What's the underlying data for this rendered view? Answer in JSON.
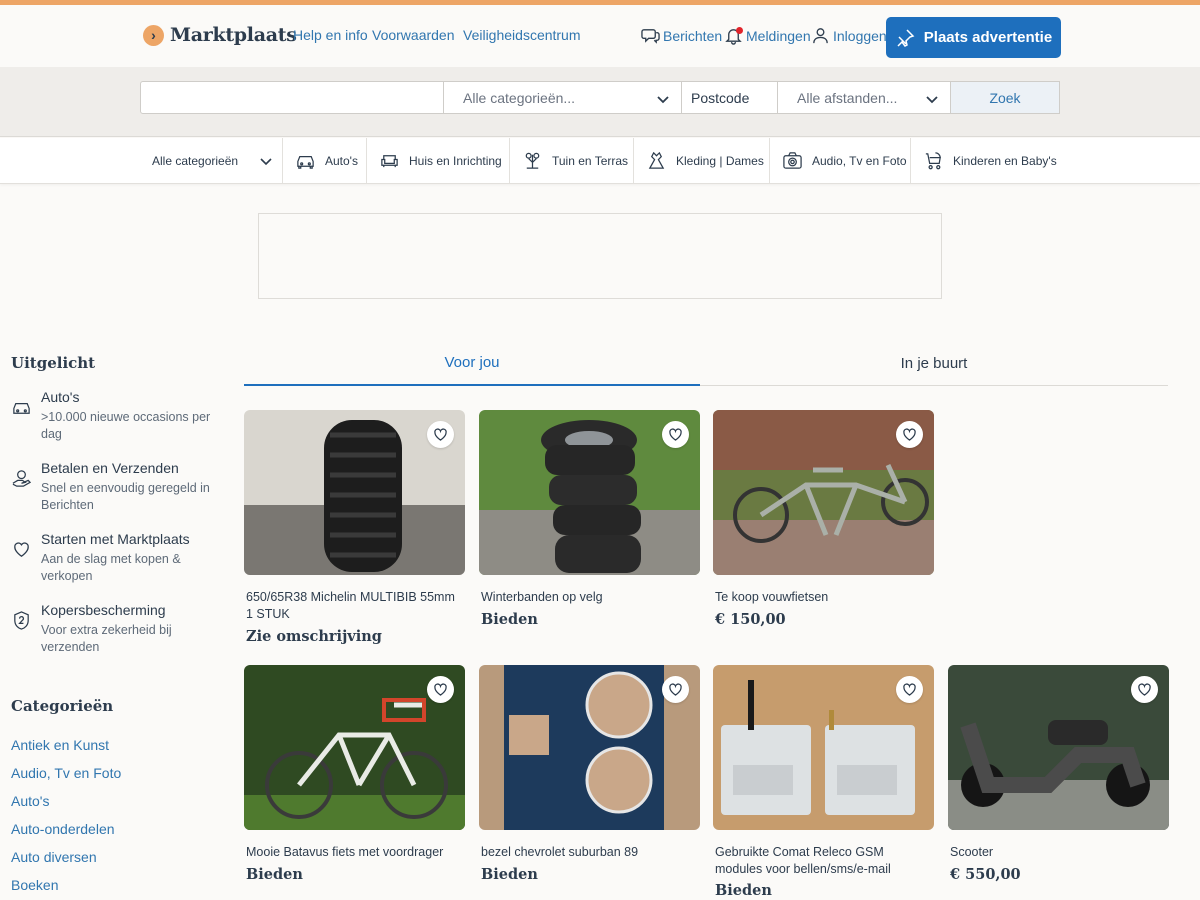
{
  "header": {
    "logo_text": "Marktplaats",
    "links": [
      "Help en info",
      "Voorwaarden",
      "Veiligheidscentrum"
    ],
    "actions": {
      "messages": "Berichten",
      "notifications": "Meldingen",
      "login": "Inloggen"
    },
    "place_ad": "Plaats advertentie"
  },
  "search": {
    "query_value": "",
    "category": "Alle categorieën...",
    "postcode_placeholder": "Postcode",
    "distance": "Alle afstanden...",
    "button": "Zoek"
  },
  "category_bar": {
    "all": "Alle categorieën",
    "items": [
      {
        "label": "Auto's",
        "icon": "car-icon"
      },
      {
        "label": "Huis en Inrichting",
        "icon": "sofa-icon"
      },
      {
        "label": "Tuin en Terras",
        "icon": "garden-icon"
      },
      {
        "label": "Kleding | Dames",
        "icon": "dress-icon"
      },
      {
        "label": "Audio, Tv en Foto",
        "icon": "camera-icon"
      },
      {
        "label": "Kinderen en Baby's",
        "icon": "stroller-icon"
      }
    ]
  },
  "sidebar": {
    "featured_heading": "Uitgelicht",
    "featured": [
      {
        "title": "Auto's",
        "desc": ">10.000 nieuwe occasions per dag",
        "icon": "car-icon"
      },
      {
        "title": "Betalen en Verzenden",
        "desc": "Snel en eenvoudig geregeld in Berichten",
        "icon": "hand-coin-icon"
      },
      {
        "title": "Starten met Marktplaats",
        "desc": "Aan de slag met kopen & verkopen",
        "icon": "heart-icon"
      },
      {
        "title": "Kopersbescherming",
        "desc": "Voor extra zekerheid bij verzenden",
        "icon": "shield-icon"
      }
    ],
    "categories_heading": "Categorieën",
    "categories": [
      "Antiek en Kunst",
      "Audio, Tv en Foto",
      "Auto's",
      "Auto-onderdelen",
      "Auto diversen",
      "Boeken"
    ]
  },
  "tabs": {
    "active": "Voor jou",
    "inactive": "In je buurt"
  },
  "listings": [
    {
      "title": "650/65R38 Michelin MULTIBIB 55mm 1 STUK",
      "price": "Zie omschrijving"
    },
    {
      "title": "Winterbanden op velg",
      "price": "Bieden"
    },
    {
      "title": "Te koop vouwfietsen",
      "price": "€ 150,00"
    },
    {
      "title": "Mooie Batavus fiets met voordrager",
      "price": "Bieden"
    },
    {
      "title": "bezel chevrolet suburban 89",
      "price": "Bieden"
    },
    {
      "title": "Gebruikte Comat Releco GSM modules voor bellen/sms/e-mail",
      "price": "Bieden"
    },
    {
      "title": "Scooter",
      "price": "€ 550,00"
    }
  ],
  "colors": {
    "accent": "#eda566",
    "primary": "#1e6fbd",
    "link": "#3176af",
    "text": "#2d3c4d"
  }
}
